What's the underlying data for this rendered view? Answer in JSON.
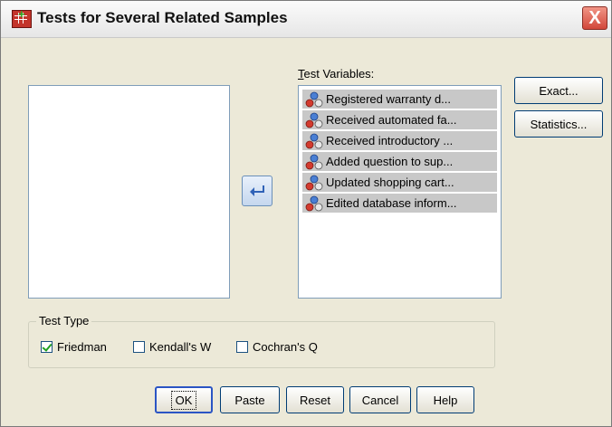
{
  "window": {
    "title": "Tests for Several Related Samples",
    "close": "X"
  },
  "test_variables": {
    "label": "Test Variables:",
    "items": [
      "Registered warranty d...",
      "Received automated fa...",
      "Received introductory ...",
      "Added question to sup...",
      "Updated shopping cart...",
      "Edited database inform..."
    ]
  },
  "buttons": {
    "exact": "Exact...",
    "statistics": "Statistics...",
    "ok": "OK",
    "paste": "Paste",
    "reset": "Reset",
    "cancel": "Cancel",
    "help": "Help"
  },
  "test_type": {
    "label": "Test Type",
    "friedman": {
      "label": "Friedman",
      "checked": true
    },
    "kendall": {
      "label": "Kendall's W",
      "checked": false
    },
    "cochran": {
      "label": "Cochran's Q",
      "checked": false
    }
  },
  "icon_names": [
    "app-icon",
    "nominal-variable-icon",
    "move-arrow-icon",
    "close-icon"
  ]
}
